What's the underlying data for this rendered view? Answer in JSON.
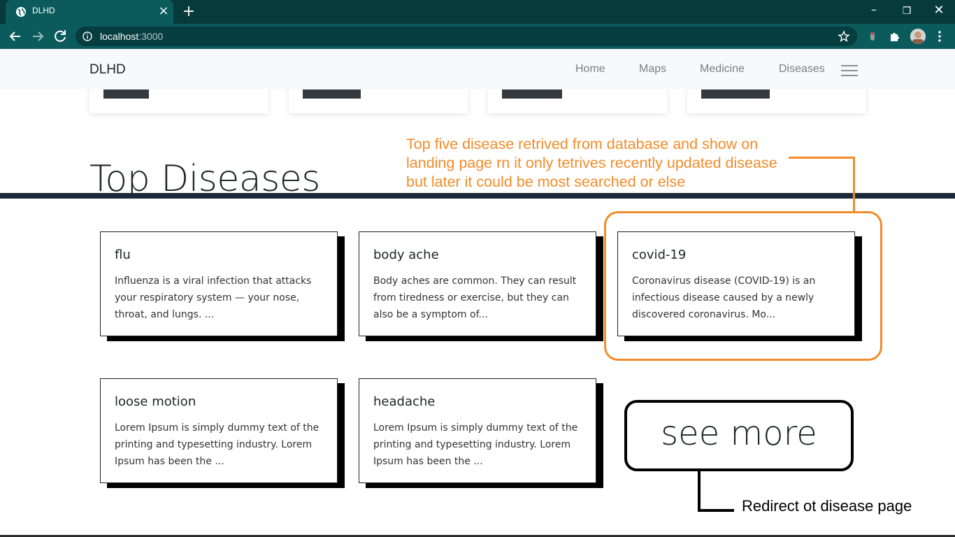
{
  "browser": {
    "tab_title": "DLHD",
    "url_host": "localhost",
    "url_port": ":3000"
  },
  "navbar": {
    "brand": "DLHD",
    "links": [
      "Home",
      "Maps",
      "Medicine",
      "Diseases"
    ]
  },
  "section": {
    "title": "Top Diseases"
  },
  "diseases": [
    {
      "name": "flu",
      "summary": "Influenza is a viral infection that attacks your respiratory system — your nose, throat, and lungs. ..."
    },
    {
      "name": "body ache",
      "summary": "Body aches are common. They can result from tiredness or exercise, but they can also be a symptom of..."
    },
    {
      "name": "covid-19",
      "summary": "Coronavirus disease (COVID-19) is an infectious disease caused by a newly discovered coronavirus. Mo..."
    },
    {
      "name": "loose motion",
      "summary": "Lorem Ipsum is simply dummy text of the printing and typesetting industry. Lorem Ipsum has been the ..."
    },
    {
      "name": "headache",
      "summary": "Lorem Ipsum is simply dummy text of the printing and typesetting industry. Lorem Ipsum has been the ..."
    }
  ],
  "see_more": "see more",
  "annotations": {
    "top_note": "Top five disease retrived from database and show on landing page rn it only tetrives recently updated disease but later it could be most searched or else",
    "redirect_note": "Redirect ot disease page"
  },
  "colors": {
    "chrome_dark": "#063a3b",
    "chrome_tab": "#0b5a5c",
    "annotation": "#f28c2a",
    "divider": "#1b2a3a"
  }
}
